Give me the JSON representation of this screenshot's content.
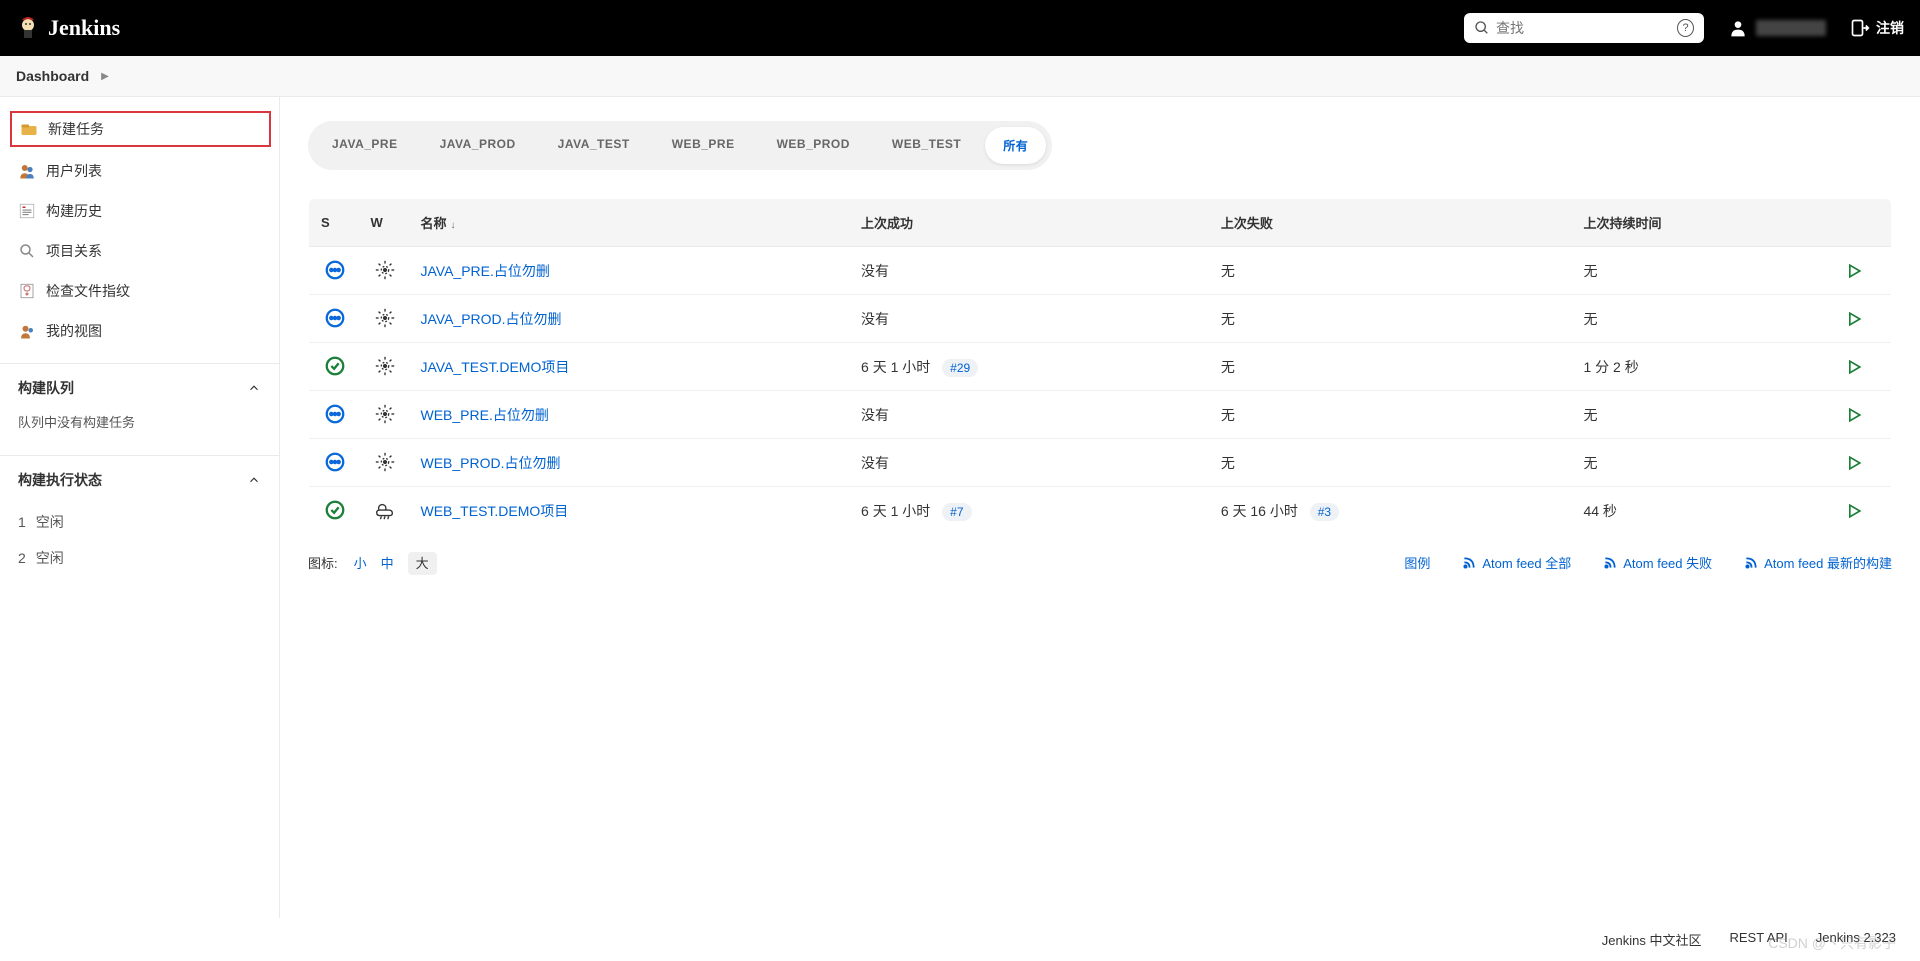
{
  "header": {
    "brand": "Jenkins",
    "search_placeholder": "查找",
    "logout": "注销"
  },
  "breadcrumb": {
    "item": "Dashboard"
  },
  "sidebar": {
    "items": [
      {
        "label": "新建任务"
      },
      {
        "label": "用户列表"
      },
      {
        "label": "构建历史"
      },
      {
        "label": "项目关系"
      },
      {
        "label": "检查文件指纹"
      },
      {
        "label": "我的视图"
      }
    ],
    "queue": {
      "title": "构建队列",
      "empty": "队列中没有构建任务"
    },
    "executors": {
      "title": "构建执行状态",
      "list": [
        {
          "num": "1",
          "state": "空闲"
        },
        {
          "num": "2",
          "state": "空闲"
        }
      ]
    }
  },
  "tabs": [
    "JAVA_PRE",
    "JAVA_PROD",
    "JAVA_TEST",
    "WEB_PRE",
    "WEB_PROD",
    "WEB_TEST",
    "所有"
  ],
  "active_tab": 6,
  "columns": {
    "s": "S",
    "w": "W",
    "name": "名称",
    "success": "上次成功",
    "fail": "上次失败",
    "duration": "上次持续时间"
  },
  "jobs": [
    {
      "status": "notbuilt",
      "weather": "sun-dot",
      "name": "JAVA_PRE.占位勿删",
      "success": "没有",
      "success_build": "",
      "fail": "无",
      "fail_build": "",
      "duration": "无"
    },
    {
      "status": "notbuilt",
      "weather": "sun-dot",
      "name": "JAVA_PROD.占位勿删",
      "success": "没有",
      "success_build": "",
      "fail": "无",
      "fail_build": "",
      "duration": "无"
    },
    {
      "status": "success",
      "weather": "sun-dot",
      "name": "JAVA_TEST.DEMO项目",
      "success": "6 天 1 小时",
      "success_build": "#29",
      "fail": "无",
      "fail_build": "",
      "duration": "1 分 2 秒"
    },
    {
      "status": "notbuilt",
      "weather": "sun-dot",
      "name": "WEB_PRE.占位勿删",
      "success": "没有",
      "success_build": "",
      "fail": "无",
      "fail_build": "",
      "duration": "无"
    },
    {
      "status": "notbuilt",
      "weather": "sun-dot",
      "name": "WEB_PROD.占位勿删",
      "success": "没有",
      "success_build": "",
      "fail": "无",
      "fail_build": "",
      "duration": "无"
    },
    {
      "status": "success",
      "weather": "cloud",
      "name": "WEB_TEST.DEMO项目",
      "success": "6 天 1 小时",
      "success_build": "#7",
      "fail": "6 天 16 小时",
      "fail_build": "#3",
      "duration": "44 秒"
    }
  ],
  "table_footer": {
    "icon_label": "图标:",
    "sizes": [
      "小",
      "中",
      "大"
    ],
    "active_size": 2,
    "legend": "图例",
    "feeds": [
      "Atom feed 全部",
      "Atom feed 失败",
      "Atom feed 最新的构建"
    ]
  },
  "bottom": {
    "community": "Jenkins 中文社区",
    "rest": "REST API",
    "version": "Jenkins 2.323"
  },
  "watermark": "CSDN @丶只有影子"
}
